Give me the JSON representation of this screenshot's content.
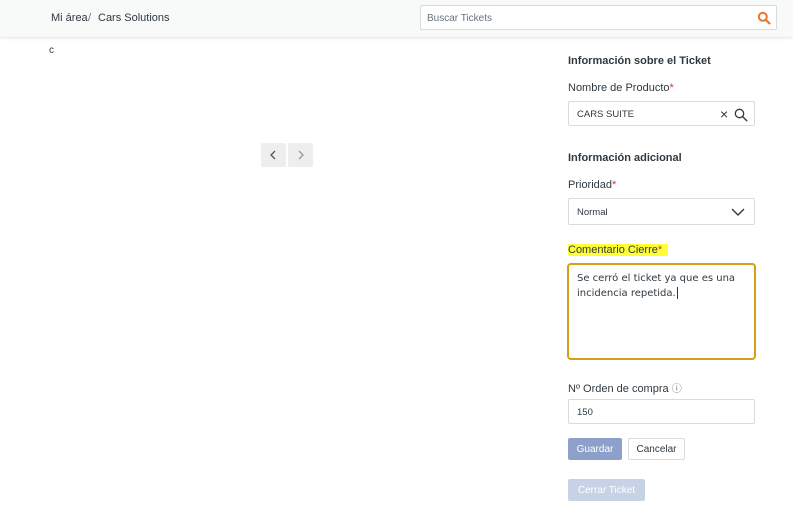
{
  "breadcrumb": {
    "home": "Mi área",
    "separator": "/",
    "current": "Cars Solutions"
  },
  "search": {
    "placeholder": "Buscar Tickets",
    "icon": "search-icon",
    "icon_color": "#e8762d"
  },
  "content": {
    "stray_text": "c"
  },
  "pager": {
    "prev_icon": "chevron-left-icon",
    "next_icon": "chevron-right-icon"
  },
  "ticket_info": {
    "title": "Información sobre el Ticket",
    "product_label": "Nombre de Producto",
    "required_mark": "*",
    "product_value": "CARS SUITE",
    "clear_glyph": "×"
  },
  "additional": {
    "title": "Información adicional",
    "priority_label": "Prioridad",
    "priority_value": "Normal",
    "closing_comment_label": "Comentario Cierre",
    "closing_comment_value": "Se cerró el ticket ya que es una incidencia repetida.",
    "purchase_order_label": "Nº Orden de compra",
    "purchase_order_value": "150",
    "info_icon": "ⓘ"
  },
  "actions": {
    "save": "Guardar",
    "cancel": "Cancelar",
    "close_ticket": "Cerrar Ticket"
  },
  "colors": {
    "required": "#cc3340",
    "highlight": "#ffff33",
    "focus_border": "#d4a017",
    "primary_button": "#8da0c9"
  }
}
